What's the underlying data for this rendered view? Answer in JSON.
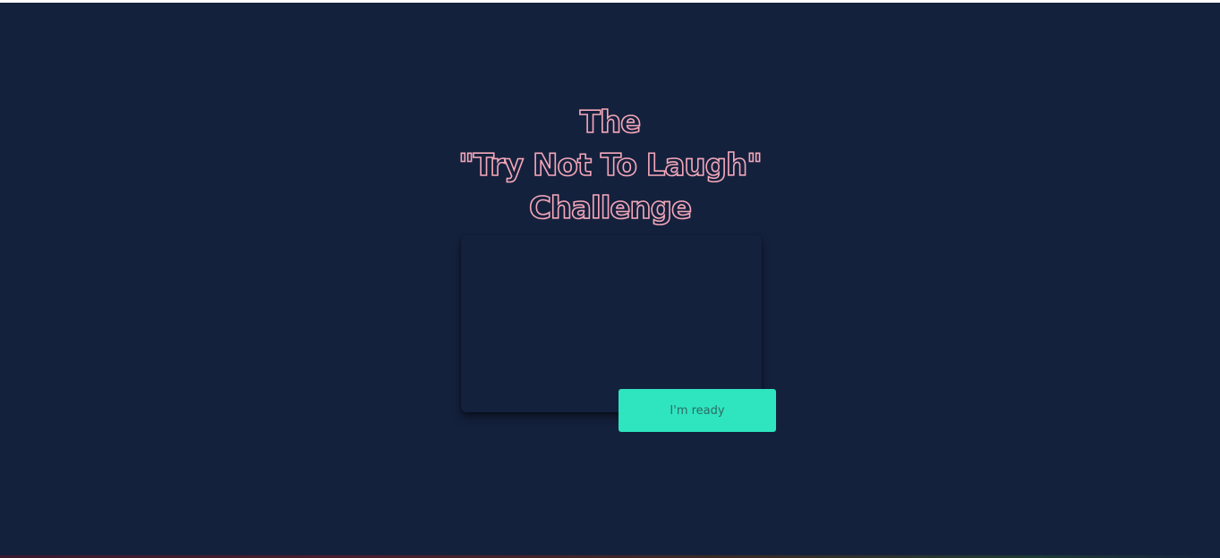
{
  "title": {
    "line1": "The",
    "line2": "\"Try Not To Laugh\"",
    "line3": "Challenge"
  },
  "actions": {
    "ready_label": "I'm ready"
  },
  "colors": {
    "background": "#14213d",
    "title_outline": "#f4a7b9",
    "button": "#2ee5c0"
  }
}
